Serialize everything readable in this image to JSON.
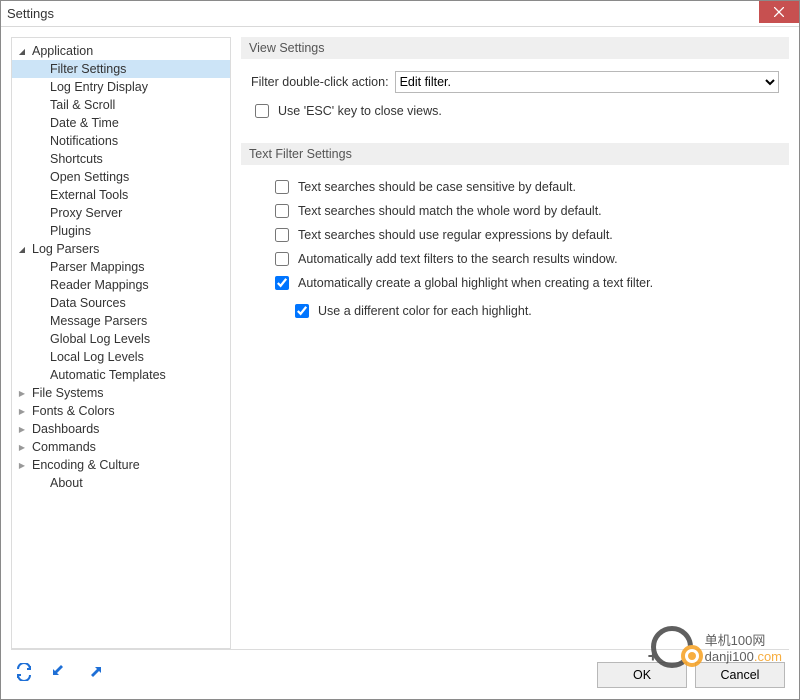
{
  "window": {
    "title": "Settings"
  },
  "tree": [
    {
      "label": "Application",
      "level": 0,
      "expanded": true
    },
    {
      "label": "Filter Settings",
      "level": 1,
      "selected": true
    },
    {
      "label": "Log Entry Display",
      "level": 1
    },
    {
      "label": "Tail & Scroll",
      "level": 1
    },
    {
      "label": "Date & Time",
      "level": 1
    },
    {
      "label": "Notifications",
      "level": 1
    },
    {
      "label": "Shortcuts",
      "level": 1
    },
    {
      "label": "Open Settings",
      "level": 1
    },
    {
      "label": "External Tools",
      "level": 1
    },
    {
      "label": "Proxy Server",
      "level": 1
    },
    {
      "label": "Plugins",
      "level": 1
    },
    {
      "label": "Log Parsers",
      "level": 0,
      "expanded": true
    },
    {
      "label": "Parser Mappings",
      "level": 1
    },
    {
      "label": "Reader Mappings",
      "level": 1
    },
    {
      "label": "Data Sources",
      "level": 1
    },
    {
      "label": "Message Parsers",
      "level": 1
    },
    {
      "label": "Global Log Levels",
      "level": 1
    },
    {
      "label": "Local Log Levels",
      "level": 1
    },
    {
      "label": "Automatic Templates",
      "level": 1
    },
    {
      "label": "File Systems",
      "level": 0,
      "expanded": false
    },
    {
      "label": "Fonts & Colors",
      "level": 0,
      "expanded": false
    },
    {
      "label": "Dashboards",
      "level": 0,
      "expanded": false
    },
    {
      "label": "Commands",
      "level": 0,
      "expanded": false
    },
    {
      "label": "Encoding & Culture",
      "level": 0,
      "expanded": false
    },
    {
      "label": "About",
      "level": 1
    }
  ],
  "main": {
    "section1": {
      "title": "View Settings",
      "dblclick_label": "Filter double-click action:",
      "dblclick_value": "Edit filter.",
      "esc_label": "Use 'ESC' key to close views.",
      "esc_checked": false
    },
    "section2": {
      "title": "Text Filter Settings",
      "items": [
        {
          "label": "Text searches should be case sensitive by default.",
          "checked": false
        },
        {
          "label": "Text searches should match the whole word by default.",
          "checked": false
        },
        {
          "label": "Text searches should use regular expressions by default.",
          "checked": false
        },
        {
          "label": "Automatically add text filters to the search results window.",
          "checked": false
        },
        {
          "label": "Automatically create a global highlight when creating a text filter.",
          "checked": true
        }
      ],
      "sub": {
        "label": "Use a different color for each highlight.",
        "checked": true
      }
    }
  },
  "footer": {
    "ok": "OK",
    "cancel": "Cancel"
  },
  "watermark": {
    "text_a": "单机100网",
    "text_b": "danji100",
    "text_c": ".com"
  }
}
